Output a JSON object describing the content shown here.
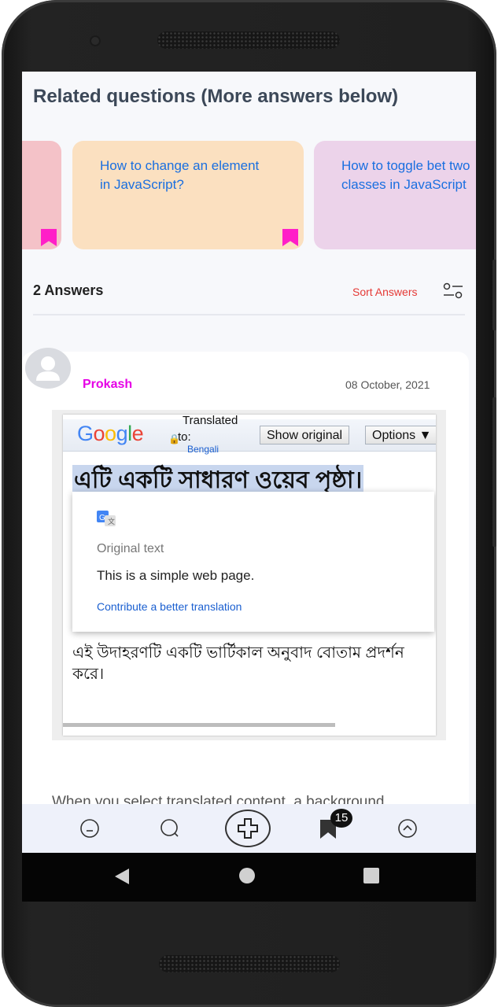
{
  "related": {
    "title": "Related questions (More answers below)",
    "cards": [
      {
        "question": "",
        "color": "#f4c2c8"
      },
      {
        "question": "How to change an element in JavaScript?",
        "color": "#fbe0c0"
      },
      {
        "question": "How to toggle bet two classes in JavaScript",
        "color": "#ecd3ea"
      }
    ]
  },
  "answers": {
    "count_label": "2 Answers",
    "sort_label": "Sort Answers"
  },
  "answer": {
    "author": "Prokash",
    "date": "08 October, 2021",
    "screenshot": {
      "google_logo": "Google",
      "translated_label": "Translated",
      "to_label": "to:",
      "language": "Bengali",
      "show_original": "Show original",
      "options": "Options ▼",
      "heading_bn": "এটি একটি সাধারণ ওয়েব পৃষ্ঠা।",
      "popup": {
        "original_label": "Original text",
        "original_text": "This is a simple web page.",
        "contribute": "Contribute a better translation"
      },
      "paragraph_bn": "এই উদাহরণটি একটি ভার্টিকাল অনুবাদ বোতাম প্রদর্শন করে।"
    },
    "body_text": "When you select translated content, a background"
  },
  "bottom_nav": {
    "badge_count": "15",
    "items": [
      "home-icon",
      "search-icon",
      "add-icon",
      "bookmark-icon",
      "scroll-top-icon"
    ]
  },
  "colors": {
    "accent_pink": "#ff1fc8",
    "link_blue": "#1a6fe0",
    "sort_red": "#e53935"
  }
}
